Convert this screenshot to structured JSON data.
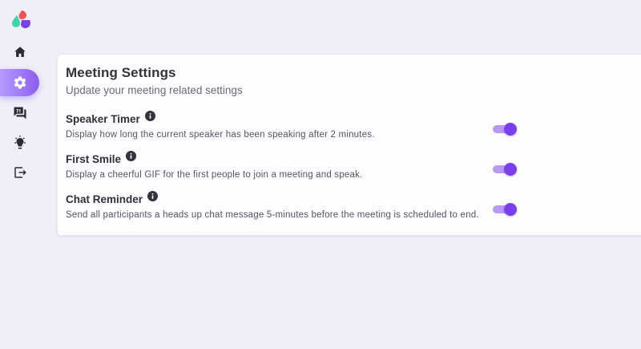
{
  "sidebar": {
    "logo": "app-logo",
    "items": [
      {
        "icon": "home-icon",
        "active": false
      },
      {
        "icon": "gear-icon",
        "active": true
      },
      {
        "icon": "question-chat-icon",
        "active": false
      },
      {
        "icon": "lightbulb-icon",
        "active": false
      },
      {
        "icon": "logout-icon",
        "active": false
      }
    ]
  },
  "card": {
    "title": "Meeting Settings",
    "subtitle": "Update your meeting related settings",
    "settings": [
      {
        "title": "Speaker Timer",
        "description": "Display how long the current speaker has been speaking after 2 minutes.",
        "enabled": true
      },
      {
        "title": "First Smile",
        "description": "Display a cheerful GIF for the first people to join a meeting and speak.",
        "enabled": true
      },
      {
        "title": "Chat Reminder",
        "description": "Send all participants a heads up chat message 5-minutes before the meeting is scheduled to end.",
        "enabled": true
      }
    ]
  },
  "colors": {
    "background": "#efeff7",
    "accent": "#7c3fee",
    "accent_light": "#b79af0",
    "active_nav_gradient_start": "#b79bff",
    "active_nav_gradient_end": "#8c5cf0"
  }
}
